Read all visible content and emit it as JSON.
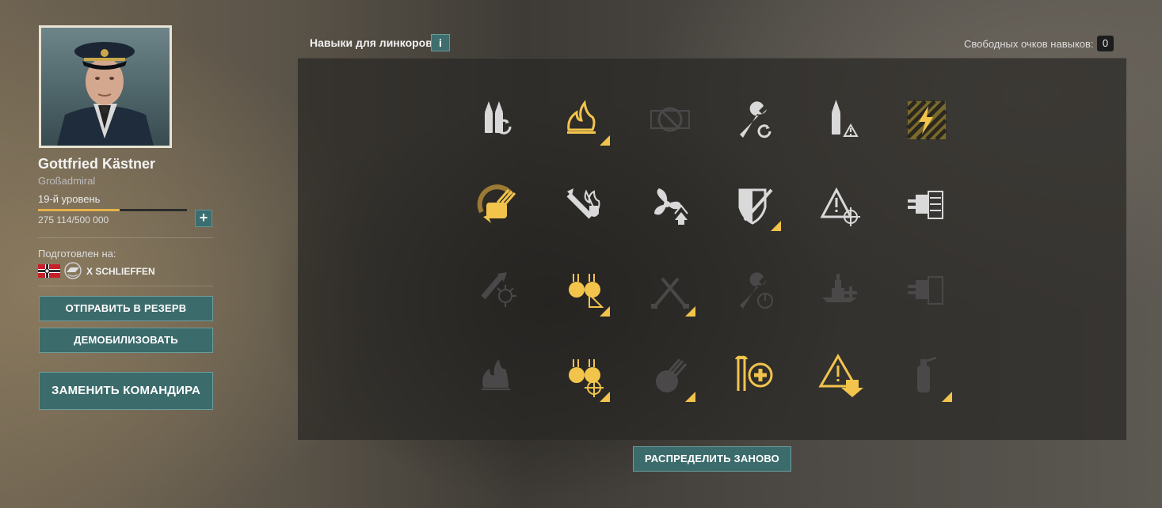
{
  "commander": {
    "name": "Gottfried Kästner",
    "rank": "Großadmiral",
    "level": "19-й уровень",
    "xp_current": "275 114",
    "xp_separator": "/",
    "xp_total": "500 000",
    "xp_progress": 0.55,
    "add_button": "+"
  },
  "trained": {
    "label": "Подготовлен на:",
    "nation_flag": "germany-flag-icon",
    "ship_class_icon": "battleship-badge-icon",
    "ship_name": "X SCHLIEFFEN"
  },
  "actions": {
    "reserve": "ОТПРАВИТЬ В РЕЗЕРВ",
    "demobilize": "ДЕМОБИЛИЗОВАТЬ",
    "replace": "ЗАМЕНИТЬ КОМАНДИРА"
  },
  "skills_panel": {
    "title": "Навыки для линкоров",
    "info_label": "i",
    "free_points_label": "Свободных очков навыков:",
    "free_points_value": "0",
    "redistribute_button": "РАСПРЕДЕЛИТЬ ЗАНОВО"
  },
  "colors": {
    "accent_gold": "#f2c44c",
    "learned_white": "#d9d9d9",
    "locked_gray": "#4a4848",
    "button_teal": "#3c6b6c"
  },
  "skills": [
    [
      {
        "icon": "shells-reload-icon",
        "state": "available",
        "upgrade": false
      },
      {
        "icon": "fire-icon",
        "state": "learned",
        "upgrade": true
      },
      {
        "icon": "no-entry-icon",
        "state": "locked",
        "upgrade": false
      },
      {
        "icon": "wrench-reload-icon",
        "state": "available",
        "upgrade": false
      },
      {
        "icon": "shell-warning-icon",
        "state": "available",
        "upgrade": false
      },
      {
        "icon": "lightning-hazard-icon",
        "state": "learned",
        "upgrade": false
      }
    ],
    [
      {
        "icon": "turret-traverse-icon",
        "state": "learned",
        "upgrade": false
      },
      {
        "icon": "burning-shield-icon",
        "state": "available",
        "upgrade": false
      },
      {
        "icon": "propeller-icon",
        "state": "available",
        "upgrade": false
      },
      {
        "icon": "armor-shield-icon",
        "state": "available",
        "upgrade": true
      },
      {
        "icon": "warning-crosshair-icon",
        "state": "available",
        "upgrade": false
      },
      {
        "icon": "secondary-battery-icon",
        "state": "available",
        "upgrade": false
      }
    ],
    [
      {
        "icon": "flak-burst-icon",
        "state": "locked",
        "upgrade": false
      },
      {
        "icon": "aa-guns-icon",
        "state": "learned",
        "upgrade": true
      },
      {
        "icon": "crossed-tools-icon",
        "state": "locked",
        "upgrade": true
      },
      {
        "icon": "wrench-gauge-icon",
        "state": "locked",
        "upgrade": false
      },
      {
        "icon": "battleship-plus-icon",
        "state": "locked",
        "upgrade": false
      },
      {
        "icon": "secondary-locked-icon",
        "state": "locked",
        "upgrade": false
      }
    ],
    [
      {
        "icon": "fire-burst-icon",
        "state": "locked",
        "upgrade": false
      },
      {
        "icon": "aa-crosshair-icon",
        "state": "learned",
        "upgrade": true
      },
      {
        "icon": "turret-locked-icon",
        "state": "locked",
        "upgrade": true
      },
      {
        "icon": "repair-plus-icon",
        "state": "learned",
        "upgrade": false
      },
      {
        "icon": "warning-down-icon",
        "state": "learned",
        "upgrade": false
      },
      {
        "icon": "extinguisher-icon",
        "state": "locked",
        "upgrade": true
      }
    ]
  ]
}
